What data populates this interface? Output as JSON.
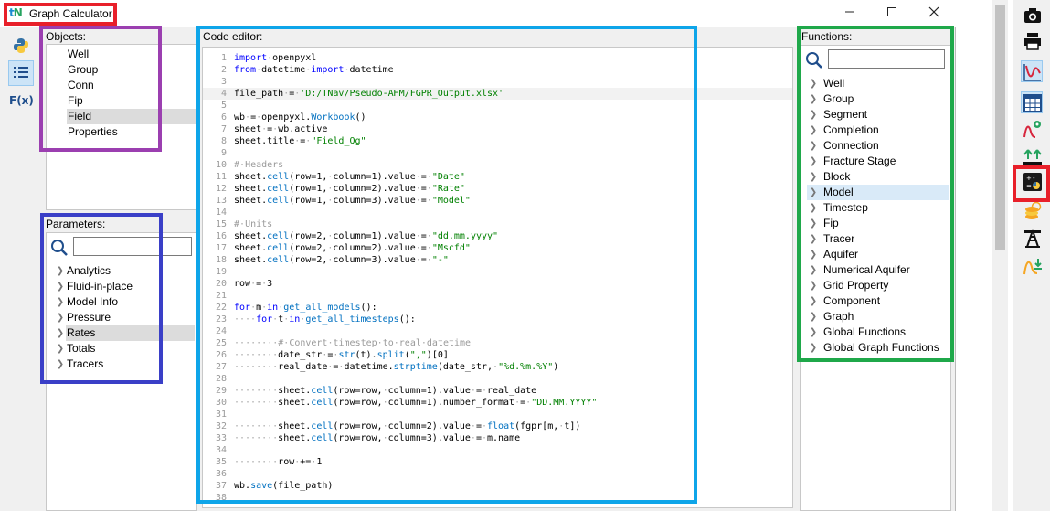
{
  "app": {
    "title": "Graph Calculator",
    "logo_text": "tN",
    "window_controls": [
      "minimize",
      "maximize",
      "close"
    ]
  },
  "left_toolbar": {
    "items": [
      {
        "icon": "python-icon",
        "active": false
      },
      {
        "icon": "list-icon",
        "active": true
      },
      {
        "icon": "function-icon",
        "label": "F(x)",
        "active": false
      }
    ]
  },
  "objects": {
    "label": "Objects:",
    "items": [
      "Well",
      "Group",
      "Conn",
      "Fip",
      "Field",
      "Properties"
    ],
    "selected": "Field"
  },
  "parameters": {
    "label": "Parameters:",
    "search_placeholder": "",
    "items": [
      "Analytics",
      "Fluid-in-place",
      "Model Info",
      "Pressure",
      "Rates",
      "Totals",
      "Tracers"
    ],
    "selected": "Rates"
  },
  "code_editor": {
    "label": "Code editor:",
    "current_line": 4,
    "lines": [
      "import openpyxl",
      "from datetime import datetime",
      "",
      "file_path = 'D:/TNav/Pseudo-AHM/FGPR_Output.xlsx'",
      "",
      "wb = openpyxl.Workbook()",
      "sheet = wb.active",
      "sheet.title = \"Field_Qg\"",
      "",
      "# Headers",
      "sheet.cell(row=1, column=1).value = \"Date\"",
      "sheet.cell(row=1, column=2).value = \"Rate\"",
      "sheet.cell(row=1, column=3).value = \"Model\"",
      "",
      "# Units",
      "sheet.cell(row=2, column=1).value = \"dd.mm.yyyy\"",
      "sheet.cell(row=2, column=2).value = \"Mscfd\"",
      "sheet.cell(row=2, column=3).value = \"-\"",
      "",
      "row = 3",
      "",
      "for m in get_all_models():",
      "    for t in get_all_timesteps():",
      "",
      "        # Convert timestep to real datetime",
      "        date_str = str(t).split(\",\")[0]",
      "        real_date = datetime.strptime(date_str, \"%d.%m.%Y\")",
      "",
      "        sheet.cell(row=row, column=1).value = real_date",
      "        sheet.cell(row=row, column=1).number_format = \"DD.MM.YYYY\"",
      "",
      "        sheet.cell(row=row, column=2).value = float(fgpr[m, t])",
      "        sheet.cell(row=row, column=3).value = m.name",
      "",
      "        row += 1",
      "",
      "wb.save(file_path)",
      ""
    ]
  },
  "functions": {
    "label": "Functions:",
    "search_placeholder": "",
    "items": [
      "Well",
      "Group",
      "Segment",
      "Completion",
      "Connection",
      "Fracture Stage",
      "Block",
      "Model",
      "Timestep",
      "Fip",
      "Tracer",
      "Aquifer",
      "Numerical Aquifer",
      "Grid Property",
      "Component",
      "Graph",
      "Global Functions",
      "Global Graph Functions"
    ],
    "selected": "Model"
  },
  "right_toolbar": {
    "items": [
      {
        "icon": "camera-icon",
        "active": false
      },
      {
        "icon": "printer-icon",
        "active": false
      },
      {
        "icon": "line-graph-icon",
        "active": true
      },
      {
        "icon": "table-icon",
        "active": true
      },
      {
        "icon": "graph-settings-icon",
        "active": false
      },
      {
        "icon": "arrows-up-icon",
        "active": false
      },
      {
        "icon": "calculator-python-icon",
        "active": false
      },
      {
        "icon": "coins-icon",
        "active": false
      },
      {
        "icon": "oil-rig-icon",
        "active": false
      },
      {
        "icon": "curve-download-icon",
        "active": false
      }
    ]
  },
  "highlight_colors": {
    "title": "#e8202a",
    "objects": "#9b3fb0",
    "parameters": "#3a3fc7",
    "code_editor": "#0ea5e9",
    "functions": "#1fa84a",
    "calculator_tool": "#e8202a"
  }
}
